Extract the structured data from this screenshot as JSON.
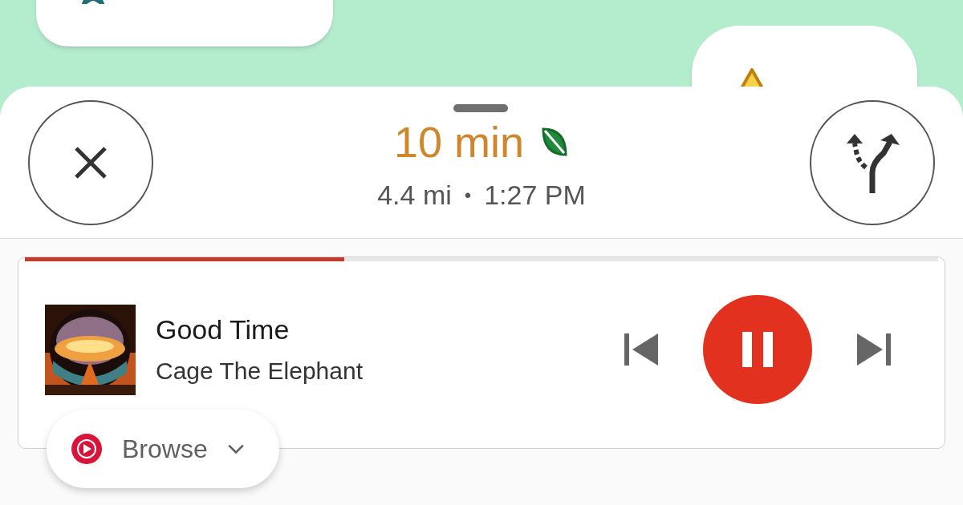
{
  "trip": {
    "eta": "10 min",
    "distance": "4.4 mi",
    "separator": "•",
    "arrival": "1:27 PM"
  },
  "media": {
    "level": 0.35,
    "title": "Good Time",
    "artist": "Cage The Elephant",
    "playing": true,
    "source_label": "Browse"
  }
}
